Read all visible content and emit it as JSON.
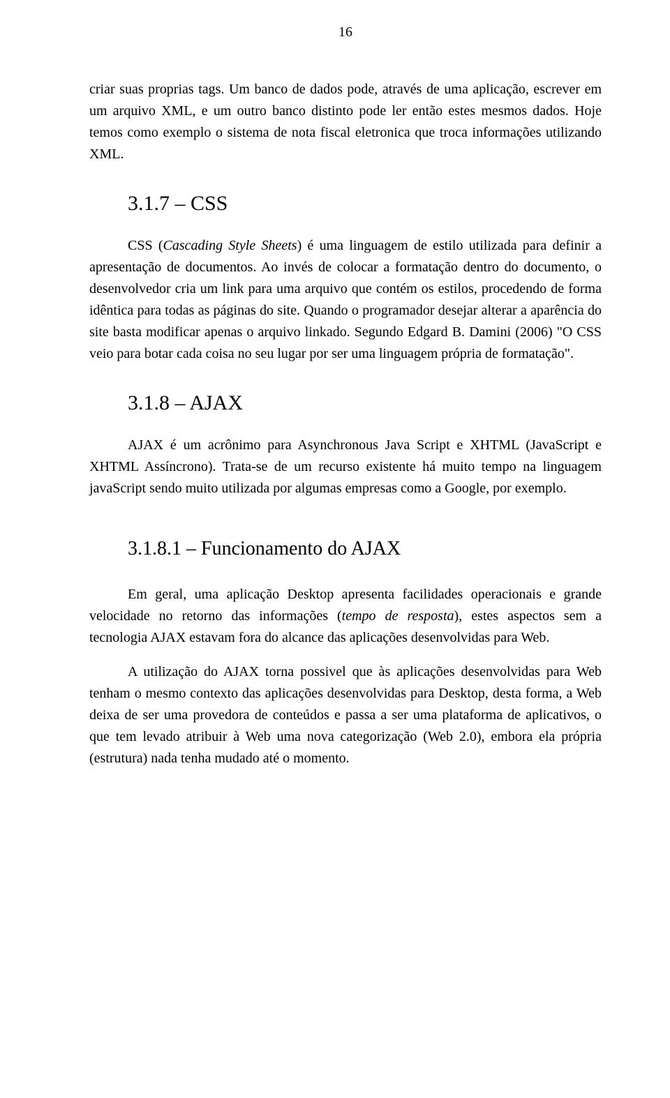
{
  "page_number": "16",
  "para_intro_1": "criar suas proprias tags. Um banco de dados pode, através de uma aplicação, escrever em um arquivo XML, e um outro banco distinto pode ler então estes mesmos dados. Hoje temos como exemplo o sistema de nota fiscal eletronica que troca informações utilizando XML.",
  "heading_css": "3.1.7 – CSS",
  "para_css_prefix": "CSS (",
  "para_css_italic": "Cascading Style Sheets",
  "para_css_rest": ") é uma linguagem de estilo utilizada para definir a apresentação de documentos. Ao invés de colocar a formatação dentro do documento, o desenvolvedor cria um link para uma arquivo que contém os estilos, procedendo de forma idêntica para todas as páginas do site. Quando o programador desejar alterar a aparência do site basta modificar apenas o arquivo linkado. Segundo Edgard B. Damini (2006) \"O CSS veio para botar cada coisa no seu lugar por ser uma linguagem própria de formatação\".",
  "heading_ajax": "3.1.8 – AJAX",
  "para_ajax": "AJAX é um acrônimo para Asynchronous Java Script e XHTML (JavaScript e XHTML Assíncrono). Trata-se de um recurso existente há muito tempo na linguagem javaScript sendo muito utilizada por algumas empresas como a Google, por exemplo.",
  "heading_func": "3.1.8.1 – Funcionamento do AJAX",
  "para_func1_a": "Em geral, uma aplicação Desktop apresenta facilidades operacionais e grande velocidade no retorno das informações (",
  "para_func1_italic": "tempo de resposta",
  "para_func1_b": "), estes aspectos sem a tecnologia AJAX estavam fora do alcance das aplicações desenvolvidas para Web.",
  "para_func2": "A utilização do AJAX torna possivel que às aplicações desenvolvidas para Web tenham  o mesmo contexto das aplicações desenvolvidas para Desktop, desta forma, a Web deixa de ser uma provedora de conteúdos e passa a ser uma plataforma de aplicativos, o que tem levado atribuir à Web uma nova categorização (Web 2.0), embora ela própria (estrutura) nada tenha mudado até o momento."
}
